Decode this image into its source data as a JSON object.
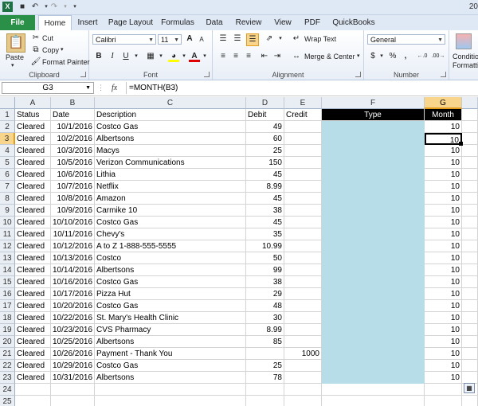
{
  "title_number": "20",
  "tabs": [
    "File",
    "Home",
    "Insert",
    "Page Layout",
    "Formulas",
    "Data",
    "Review",
    "View",
    "PDF",
    "QuickBooks"
  ],
  "ribbon": {
    "clipboard": {
      "paste": "Paste",
      "cut": "Cut",
      "copy": "Copy",
      "format_painter": "Format Painter",
      "label": "Clipboard"
    },
    "font": {
      "font_name": "Calibri",
      "font_size": "11",
      "bold": "B",
      "italic": "I",
      "underline": "U",
      "grow": "A",
      "shrink": "A",
      "font_color": "A",
      "label": "Font"
    },
    "alignment": {
      "wrap_text": "Wrap Text",
      "merge_center": "Merge & Center",
      "label": "Alignment"
    },
    "number": {
      "format": "General",
      "currency": "$",
      "percent": "%",
      "comma": ",",
      "label": "Number"
    },
    "styles": {
      "conditional": "Conditio",
      "conditional2": "Formatti"
    }
  },
  "formula_bar": {
    "name_box": "G3",
    "fx": "fx",
    "formula": "=MONTH(B3)"
  },
  "columns": [
    "A",
    "B",
    "C",
    "D",
    "E",
    "F",
    "G"
  ],
  "header_row": [
    "Status",
    "Date",
    "Description",
    "Debit",
    "Credit",
    "Type",
    "Month"
  ],
  "rows": [
    [
      "Cleared",
      "10/1/2016",
      "Costco Gas",
      "49",
      "",
      "",
      "10"
    ],
    [
      "Cleared",
      "10/2/2016",
      "Albertsons",
      "60",
      "",
      "",
      "10"
    ],
    [
      "Cleared",
      "10/3/2016",
      "Macys",
      "25",
      "",
      "",
      "10"
    ],
    [
      "Cleared",
      "10/5/2016",
      "Verizon Communications",
      "150",
      "",
      "",
      "10"
    ],
    [
      "Cleared",
      "10/6/2016",
      "Lithia",
      "45",
      "",
      "",
      "10"
    ],
    [
      "Cleared",
      "10/7/2016",
      "Netflix",
      "8.99",
      "",
      "",
      "10"
    ],
    [
      "Cleared",
      "10/8/2016",
      "Amazon",
      "45",
      "",
      "",
      "10"
    ],
    [
      "Cleared",
      "10/9/2016",
      "Carmike 10",
      "38",
      "",
      "",
      "10"
    ],
    [
      "Cleared",
      "10/10/2016",
      "Costco Gas",
      "45",
      "",
      "",
      "10"
    ],
    [
      "Cleared",
      "10/11/2016",
      "Chevy's",
      "35",
      "",
      "",
      "10"
    ],
    [
      "Cleared",
      "10/12/2016",
      "A to Z 1-888-555-5555",
      "10.99",
      "",
      "",
      "10"
    ],
    [
      "Cleared",
      "10/13/2016",
      "Costco",
      "50",
      "",
      "",
      "10"
    ],
    [
      "Cleared",
      "10/14/2016",
      "Albertsons",
      "99",
      "",
      "",
      "10"
    ],
    [
      "Cleared",
      "10/16/2016",
      "Costco Gas",
      "38",
      "",
      "",
      "10"
    ],
    [
      "Cleared",
      "10/17/2016",
      "Pizza Hut",
      "29",
      "",
      "",
      "10"
    ],
    [
      "Cleared",
      "10/20/2016",
      "Costco Gas",
      "48",
      "",
      "",
      "10"
    ],
    [
      "Cleared",
      "10/22/2016",
      "St. Mary's Health Clinic",
      "30",
      "",
      "",
      "10"
    ],
    [
      "Cleared",
      "10/23/2016",
      "CVS Pharmacy",
      "8.99",
      "",
      "",
      "10"
    ],
    [
      "Cleared",
      "10/25/2016",
      "Albertsons",
      "85",
      "",
      "",
      "10"
    ],
    [
      "Cleared",
      "10/26/2016",
      "Payment - Thank You",
      "",
      "1000",
      "",
      "10"
    ],
    [
      "Cleared",
      "10/29/2016",
      "Costco Gas",
      "25",
      "",
      "",
      "10"
    ],
    [
      "Cleared",
      "10/31/2016",
      "Albertsons",
      "78",
      "",
      "",
      "10"
    ]
  ],
  "row_numbers": [
    "1",
    "2",
    "3",
    "4",
    "5",
    "6",
    "7",
    "8",
    "9",
    "10",
    "11",
    "12",
    "13",
    "14",
    "15",
    "16",
    "17",
    "18",
    "19",
    "20",
    "21",
    "22",
    "23",
    "24",
    "25"
  ],
  "colors": {
    "type_fill": "#b7dde8",
    "header_dark": "#000000",
    "selection": "#f8d58a",
    "file_tab": "#2a8f47"
  },
  "active_cell": "G3"
}
